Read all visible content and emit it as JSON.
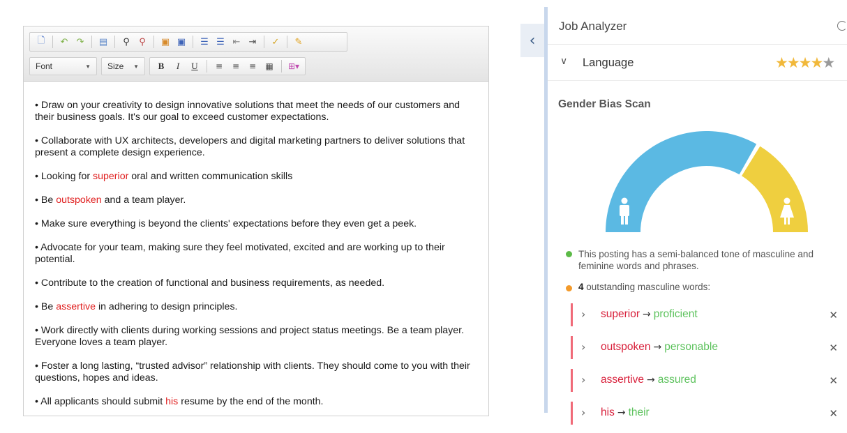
{
  "editor": {
    "toolbar": {
      "font_label": "Font",
      "size_label": "Size",
      "bold": "B",
      "italic": "I",
      "underline": "U"
    },
    "paragraphs": [
      {
        "pre": "• Draw on your creativity to design innovative solutions that meet the needs of our customers and their business goals. It's our goal to exceed customer expectations.",
        "hl": "",
        "post": ""
      },
      {
        "pre": "• Collaborate with UX architects, developers and digital marketing partners to deliver solutions that present a complete design experience.",
        "hl": "",
        "post": ""
      },
      {
        "pre": "• Looking for ",
        "hl": "superior",
        "post": " oral and written communication skills"
      },
      {
        "pre": "• Be ",
        "hl": "outspoken",
        "post": " and a team player."
      },
      {
        "pre": "• Make sure everything is beyond the clients' expectations before they even get a peek.",
        "hl": "",
        "post": ""
      },
      {
        "pre": "• Advocate for your team, making sure they feel motivated, excited and are working up to their potential.",
        "hl": "",
        "post": ""
      },
      {
        "pre": "• Contribute to the creation of functional and business requirements, as needed.",
        "hl": "",
        "post": ""
      },
      {
        "pre": "• Be ",
        "hl": "assertive",
        "post": " in adhering to design principles."
      },
      {
        "pre": "• Work directly with clients during working sessions and project status meetings. Be a team player. Everyone loves a team player.",
        "hl": "",
        "post": ""
      },
      {
        "pre": "• Foster a long lasting, “trusted advisor” relationship with clients. They should come to you with their questions, hopes and ideas.",
        "hl": "",
        "post": ""
      },
      {
        "pre": "• All applicants should submit ",
        "hl": "his",
        "post": " resume by the end of the month."
      }
    ]
  },
  "panel": {
    "title": "Job Analyzer",
    "language_label": "Language",
    "language_rating": 4,
    "language_rating_max": 5,
    "gender_bias_title": "Gender Bias Scan",
    "gauge": {
      "masculine_share": 0.67,
      "masculine_color": "#5bb9e3",
      "feminine_color": "#efcf3f"
    },
    "summary_text": "This posting has a semi-balanced tone of masculine and feminine words and phrases.",
    "summary_dot_color": "#5cba47",
    "count_value": "4",
    "count_suffix": " outstanding masculine words:",
    "count_dot_color": "#f39a2b",
    "words": [
      {
        "from": "superior",
        "to": "proficient"
      },
      {
        "from": "outspoken",
        "to": "personable"
      },
      {
        "from": "assertive",
        "to": "assured"
      },
      {
        "from": "his",
        "to": "their"
      }
    ]
  }
}
